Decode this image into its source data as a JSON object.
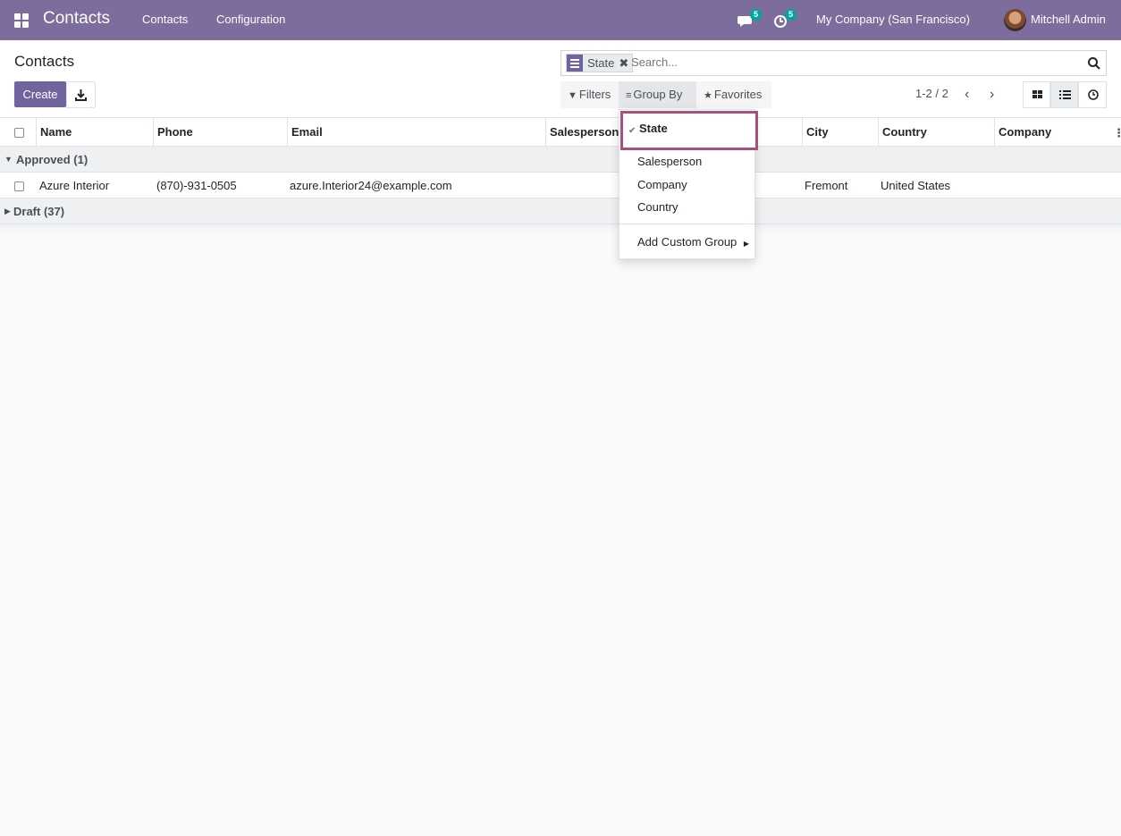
{
  "navbar": {
    "app_name": "Contacts",
    "menus": [
      "Contacts",
      "Configuration"
    ],
    "messages_count": "5",
    "activities_count": "5",
    "company": "My Company (San Francisco)",
    "user": "Mitchell Admin"
  },
  "control_panel": {
    "title": "Contacts",
    "create_label": "Create",
    "search": {
      "facet_label": "State",
      "placeholder": "Search..."
    },
    "filters_label": "Filters",
    "groupby_label": "Group By",
    "favorites_label": "Favorites",
    "pager": "1-2 / 2"
  },
  "list": {
    "columns": [
      "Name",
      "Phone",
      "Email",
      "Salesperson",
      "City",
      "Country",
      "Company"
    ],
    "groups": [
      {
        "label": "Approved (1)",
        "expanded": true
      },
      {
        "label": "Draft (37)",
        "expanded": false
      }
    ],
    "rows": [
      {
        "name": "Azure Interior",
        "phone": "(870)-931-0505",
        "email": "azure.Interior24@example.com",
        "salesperson": "",
        "city": "Fremont",
        "country": "United States",
        "company": ""
      }
    ]
  },
  "groupby_dropdown": {
    "items": [
      "State",
      "Salesperson",
      "Company",
      "Country"
    ],
    "selected": "State",
    "custom_group": "Add Custom Group"
  },
  "colors": {
    "navbar": "#7c6d9c",
    "primary": "#71639e",
    "highlight": "#a8517e",
    "badge": "#01a5a0"
  }
}
